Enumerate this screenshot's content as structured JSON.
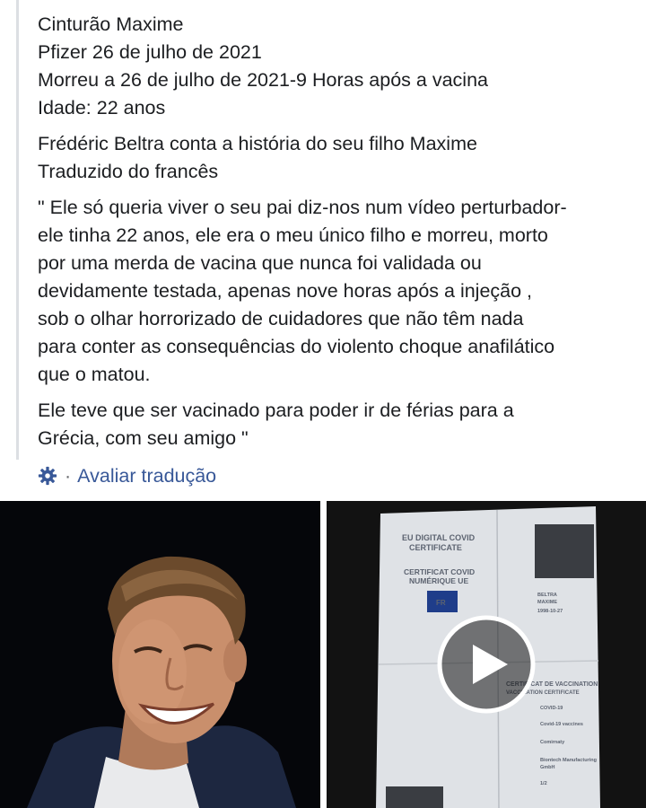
{
  "post": {
    "paragraphs": [
      [
        "Cinturão Maxime",
        "Pfizer 26 de julho de 2021",
        "Morreu a 26 de julho de 2021-9 Horas após a vacina",
        "Idade: 22 anos"
      ],
      [
        "Frédéric Beltra conta a história do seu filho Maxime",
        "Traduzido do francês"
      ],
      [
        "\" Ele só queria viver o seu pai diz-nos num vídeo perturbador-",
        "ele tinha 22 anos, ele era o meu único filho e morreu, morto",
        "por uma merda de vacina que nunca foi validada ou",
        "devidamente testada, apenas nove horas após a injeção ,",
        "sob o olhar horrorizado de cuidadores que não têm nada",
        "para conter as consequências do violento choque anafilático",
        "que o matou."
      ],
      [
        "Ele teve que ser vacinado para poder ir de férias para a",
        "Grécia, com seu amigo \""
      ]
    ]
  },
  "translation": {
    "icon": "gear-icon",
    "separator": "·",
    "rate_label": "Avaliar tradução",
    "link_color": "#385898"
  },
  "media": {
    "photo_icon": "portrait-photo",
    "video_icon": "play-icon",
    "certificate": {
      "title_en": [
        "EU DIGITAL COVID",
        "CERTIFICATE"
      ],
      "title_fr": [
        "CERTIFICAT COVID",
        "NUMÉRIQUE UE"
      ],
      "flag_code": "FR",
      "holder": [
        "BELTRA",
        "MAXIME",
        "1998-10-27"
      ],
      "vaccination_title": [
        "CERTIFICAT DE VACCINATION",
        "VACCINATION CERTIFICATE"
      ],
      "fields": [
        "COVID-19",
        "Covid-19 vaccines",
        "Comirnaty",
        "Biontech Manufacturing",
        "GmbH",
        "1/2"
      ]
    }
  }
}
